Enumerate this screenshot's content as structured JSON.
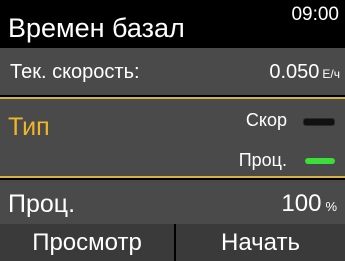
{
  "header": {
    "title": "Времен базал",
    "time": "09:00"
  },
  "current_rate": {
    "label": "Тек. скорость:",
    "value": "0.050",
    "unit": "Е/ч"
  },
  "type": {
    "label": "Тип",
    "options": [
      {
        "label": "Скор",
        "selected": false
      },
      {
        "label": "Проц.",
        "selected": true
      }
    ]
  },
  "percent": {
    "label": "Проц.",
    "value": "100",
    "unit": "%"
  },
  "softkeys": {
    "left": "Просмотр",
    "right": "Начать"
  },
  "colors": {
    "background": "#000000",
    "row_background": "#4a4a4a",
    "accent": "#f0b627",
    "selected_indicator": "#3adf3a"
  }
}
